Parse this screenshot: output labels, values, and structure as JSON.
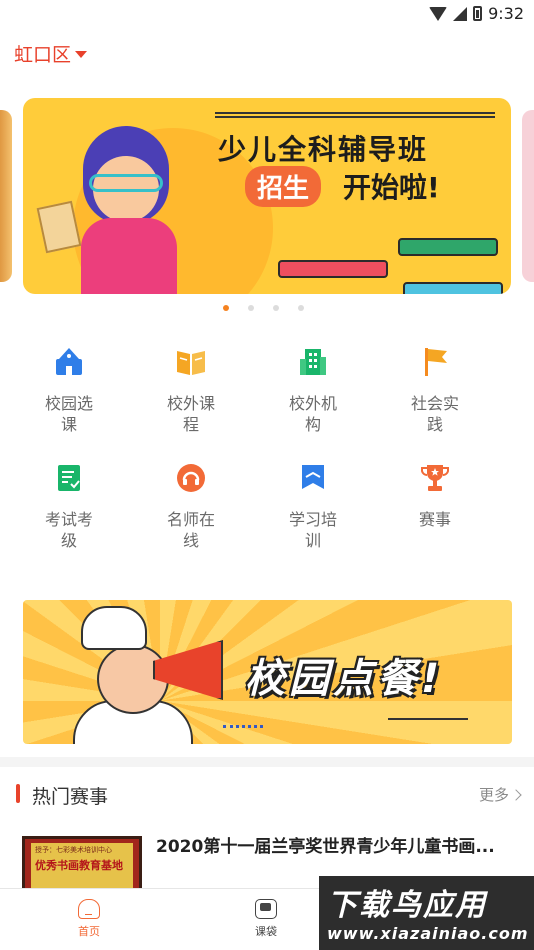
{
  "status_bar": {
    "time": "9:32"
  },
  "location": {
    "district": "虹口区"
  },
  "banner": {
    "title": "少儿全科辅导班",
    "pill": "招生",
    "subtitle": "开始啦!",
    "active_index": 0,
    "total": 4
  },
  "grid": [
    {
      "label": "校园选课",
      "icon": "school-icon",
      "color": "#2f7ee8"
    },
    {
      "label": "校外课程",
      "icon": "open-book-icon",
      "color": "#f5a623"
    },
    {
      "label": "校外机构",
      "icon": "building-icon",
      "color": "#19b56a"
    },
    {
      "label": "社会实践",
      "icon": "flag-icon",
      "color": "#f58b1f"
    },
    {
      "label": "考试考级",
      "icon": "exam-checklist-icon",
      "color": "#19b56a"
    },
    {
      "label": "名师在线",
      "icon": "headset-icon",
      "color": "#f26a37"
    },
    {
      "label": "学习培训",
      "icon": "bookmark-icon",
      "color": "#2f7ee8"
    },
    {
      "label": "赛事",
      "icon": "trophy-icon",
      "color": "#f26a37"
    }
  ],
  "canteen_banner": {
    "text": "校园点餐!"
  },
  "hot": {
    "title": "热门赛事",
    "more": "更多",
    "items": [
      {
        "title": "2020第十一届兰亭奖世界青少年儿童书画...",
        "thumb_line1": "授予：七彩美术培训中心",
        "thumb_line2": "优秀书画教育基地"
      }
    ]
  },
  "bottom_nav": [
    {
      "label": "首页",
      "icon": "home-icon",
      "active": true
    },
    {
      "label": "课袋",
      "icon": "bag-icon",
      "active": false
    }
  ],
  "watermark": {
    "top": "下载鸟应用",
    "bottom": "www.xiazainiao.com"
  }
}
